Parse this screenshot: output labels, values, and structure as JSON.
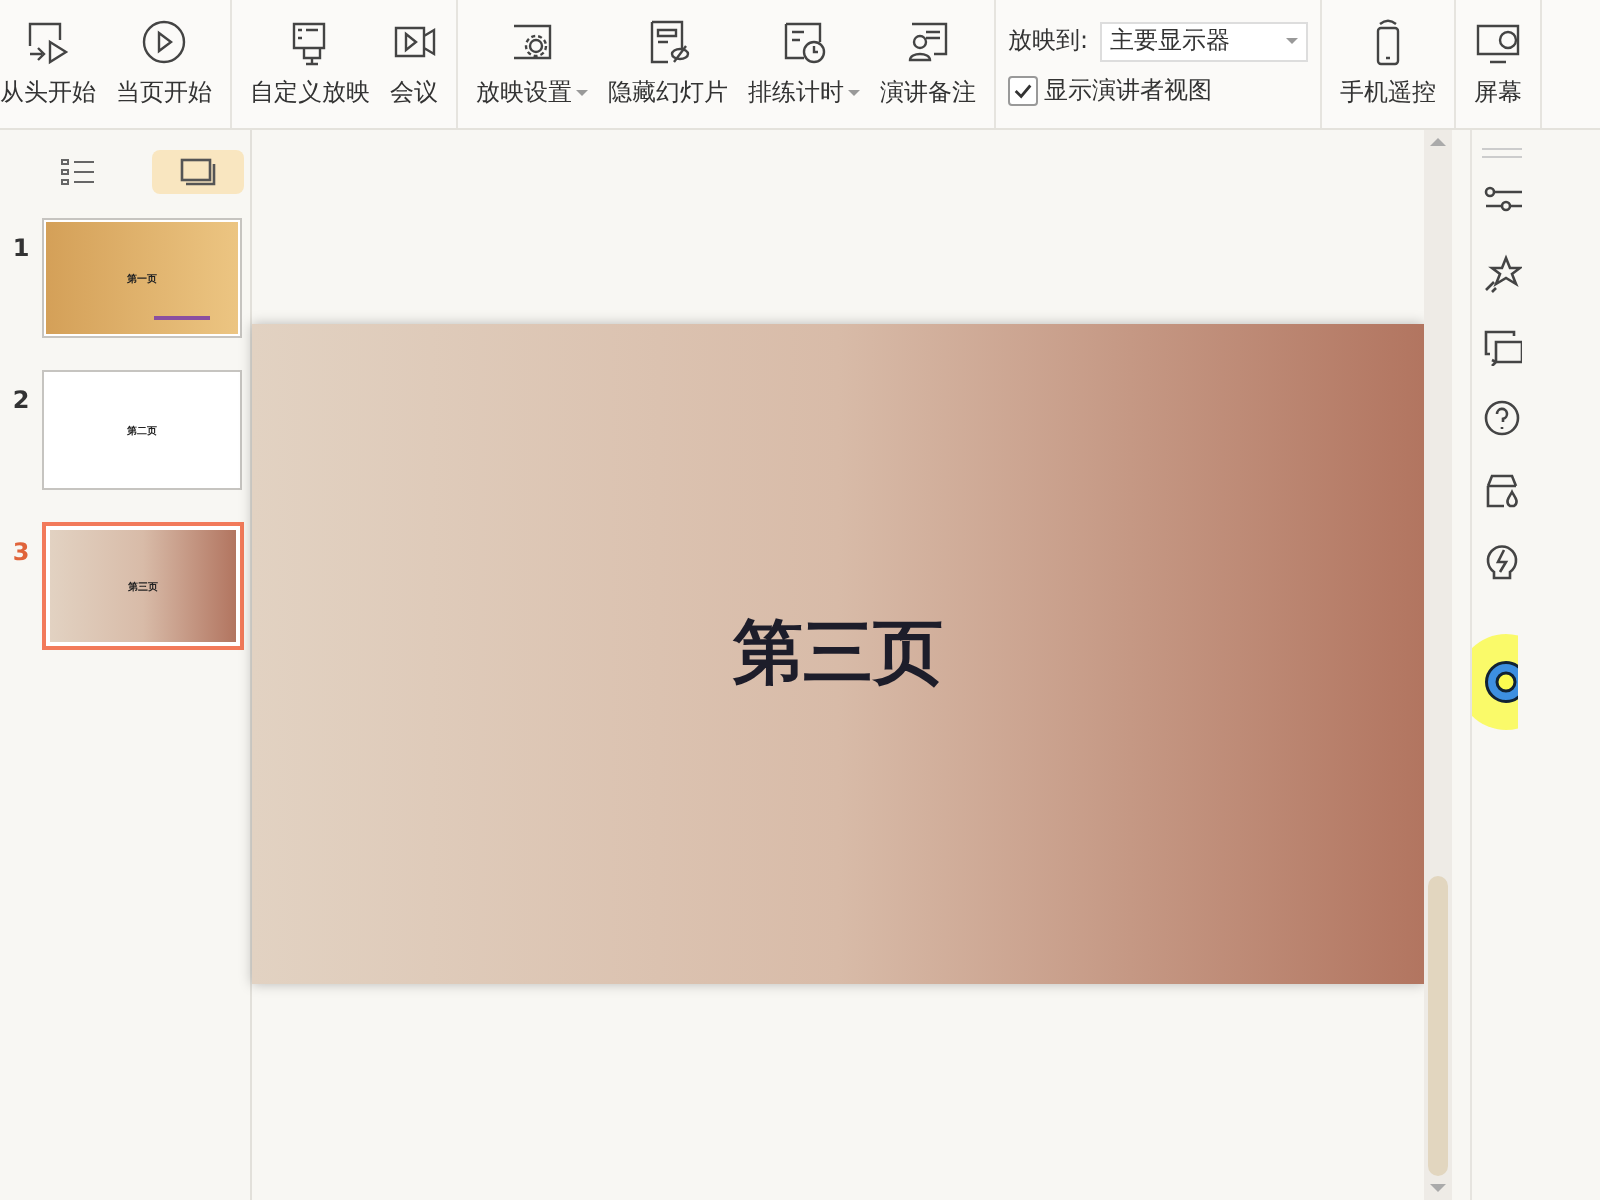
{
  "toolbar": {
    "groups": [
      {
        "buttons": [
          {
            "label": "从头开始",
            "kind": "start",
            "dropdown": false
          },
          {
            "label": "当页开始",
            "kind": "current",
            "dropdown": false
          }
        ]
      },
      {
        "buttons": [
          {
            "label": "自定义放映",
            "kind": "custom",
            "dropdown": false
          },
          {
            "label": "会议",
            "kind": "meeting",
            "dropdown": false
          }
        ]
      },
      {
        "buttons": [
          {
            "label": "放映设置",
            "kind": "settings",
            "dropdown": true
          },
          {
            "label": "隐藏幻灯片",
            "kind": "hide",
            "dropdown": false
          },
          {
            "label": "排练计时",
            "kind": "rehearse",
            "dropdown": true
          },
          {
            "label": "演讲备注",
            "kind": "notes",
            "dropdown": false
          }
        ]
      }
    ],
    "target": {
      "label": "放映到:",
      "value": "主要显示器"
    },
    "presenter_view": {
      "label": "显示演讲者视图",
      "checked": true
    },
    "extra_buttons": [
      {
        "label": "手机遥控",
        "kind": "remote"
      },
      {
        "label": "屏幕",
        "kind": "screen"
      }
    ]
  },
  "view_tabs": [
    {
      "kind": "outline",
      "selected": false
    },
    {
      "kind": "slides",
      "selected": true
    }
  ],
  "slides": [
    {
      "number": "1",
      "title": "第一页",
      "kind": "gold",
      "selected": false
    },
    {
      "number": "2",
      "title": "第二页",
      "kind": "plain",
      "selected": false
    },
    {
      "number": "3",
      "title": "第三页",
      "kind": "rose",
      "selected": true
    }
  ],
  "current_slide": {
    "title": "第三页",
    "kind": "rose"
  }
}
